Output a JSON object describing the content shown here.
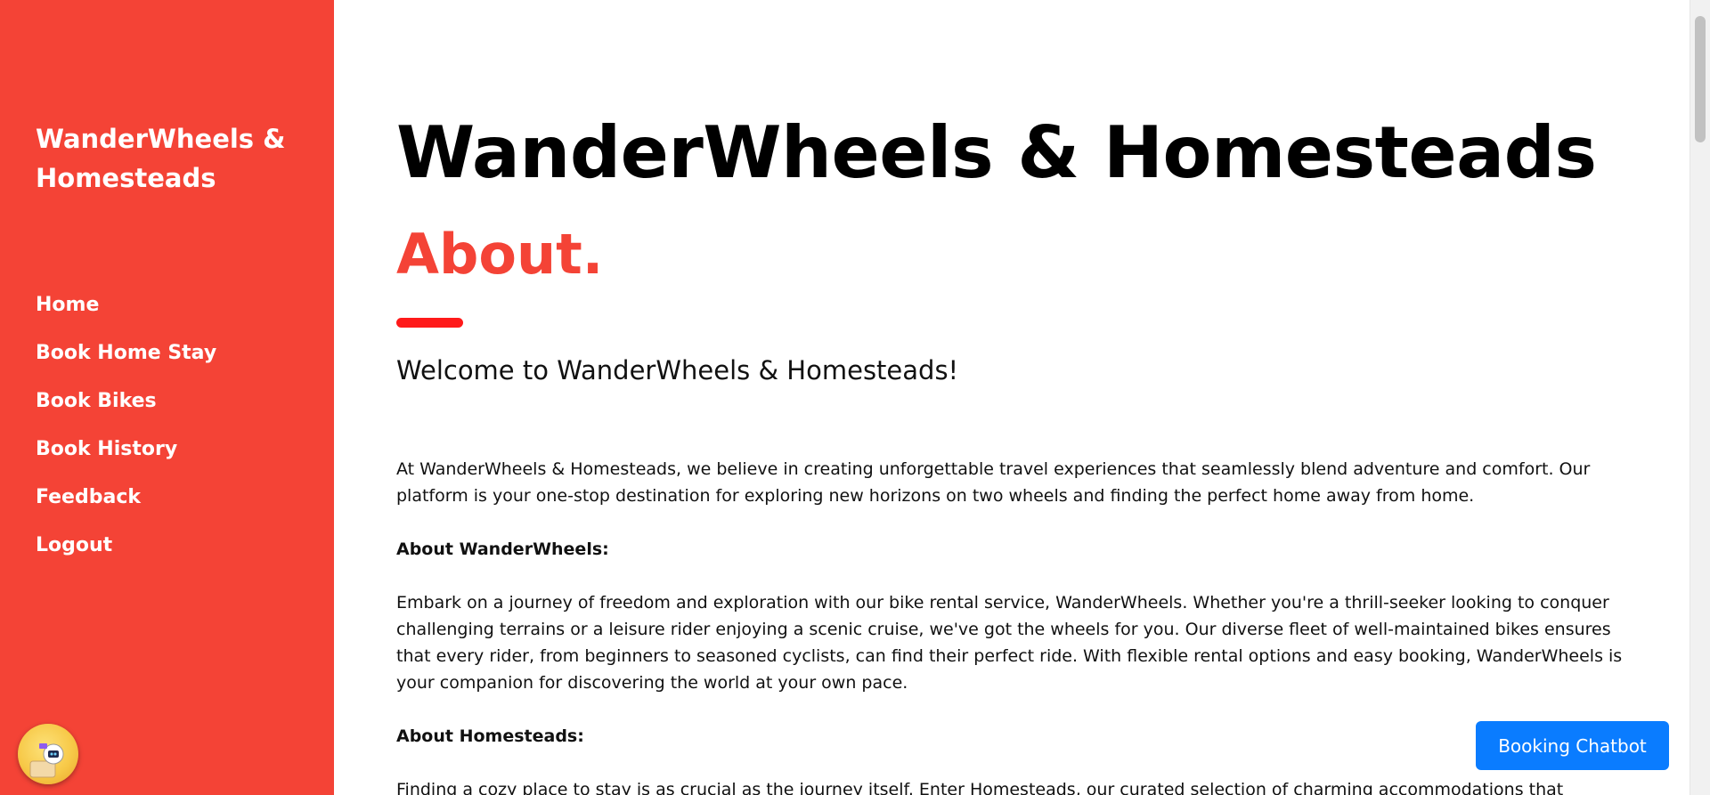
{
  "sidebar": {
    "brand": "WanderWheels & Homesteads",
    "nav": [
      {
        "label": "Home"
      },
      {
        "label": "Book Home Stay"
      },
      {
        "label": "Book Bikes"
      },
      {
        "label": "Book History"
      },
      {
        "label": "Feedback"
      },
      {
        "label": "Logout"
      }
    ],
    "bot_icon": "robot-assistant-icon"
  },
  "main": {
    "title": "WanderWheels & Homesteads",
    "about_heading": "About.",
    "welcome": "Welcome to WanderWheels & Homesteads!",
    "paragraphs": [
      "At WanderWheels & Homesteads, we believe in creating unforgettable travel experiences that seamlessly blend adventure and comfort. Our platform is your one-stop destination for exploring new horizons on two wheels and finding the perfect home away from home.",
      "About WanderWheels:",
      "Embark on a journey of freedom and exploration with our bike rental service, WanderWheels. Whether you're a thrill-seeker looking to conquer challenging terrains or a leisure rider enjoying a scenic cruise, we've got the wheels for you. Our diverse fleet of well-maintained bikes ensures that every rider, from beginners to seasoned cyclists, can find their perfect ride. With flexible rental options and easy booking, WanderWheels is your companion for discovering the world at your own pace.",
      "About Homesteads:",
      "Finding a cozy place to stay is as crucial as the journey itself. Enter Homesteads, our curated selection of charming accommodations that"
    ]
  },
  "chatbot": {
    "label": "Booking Chatbot"
  },
  "colors": {
    "sidebar_bg": "#f44336",
    "accent": "#f44336",
    "chatbot_bg": "#0a7cff"
  }
}
